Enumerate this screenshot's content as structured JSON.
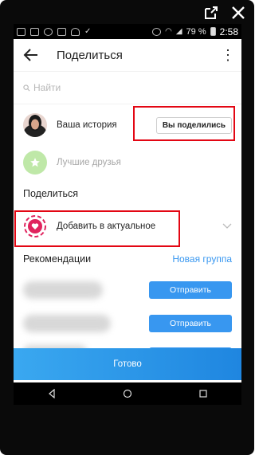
{
  "statusbar": {
    "battery": "79 %",
    "time": "2:58"
  },
  "header": {
    "title": "Поделиться"
  },
  "search": {
    "placeholder": "Найти"
  },
  "story": {
    "label": "Ваша история",
    "button": "Вы поделились"
  },
  "best_friends": {
    "label": "Лучшие друзья"
  },
  "share_section": {
    "title": "Поделиться"
  },
  "highlights": {
    "label": "Добавить в актуальное"
  },
  "recommendations": {
    "title": "Рекомендации",
    "new_group": "Новая группа",
    "send_labels": [
      "Отправить",
      "Отправить"
    ]
  },
  "done_button": "Готово",
  "colors": {
    "accent": "#3897f0",
    "highlight_red": "#e30613",
    "heart_pink": "#e0245e"
  },
  "icons": [
    "open-in-new-icon",
    "close-icon",
    "back-arrow-icon",
    "more-vert-icon",
    "search-icon",
    "star-icon",
    "heart-icon",
    "chevron-down-icon"
  ]
}
